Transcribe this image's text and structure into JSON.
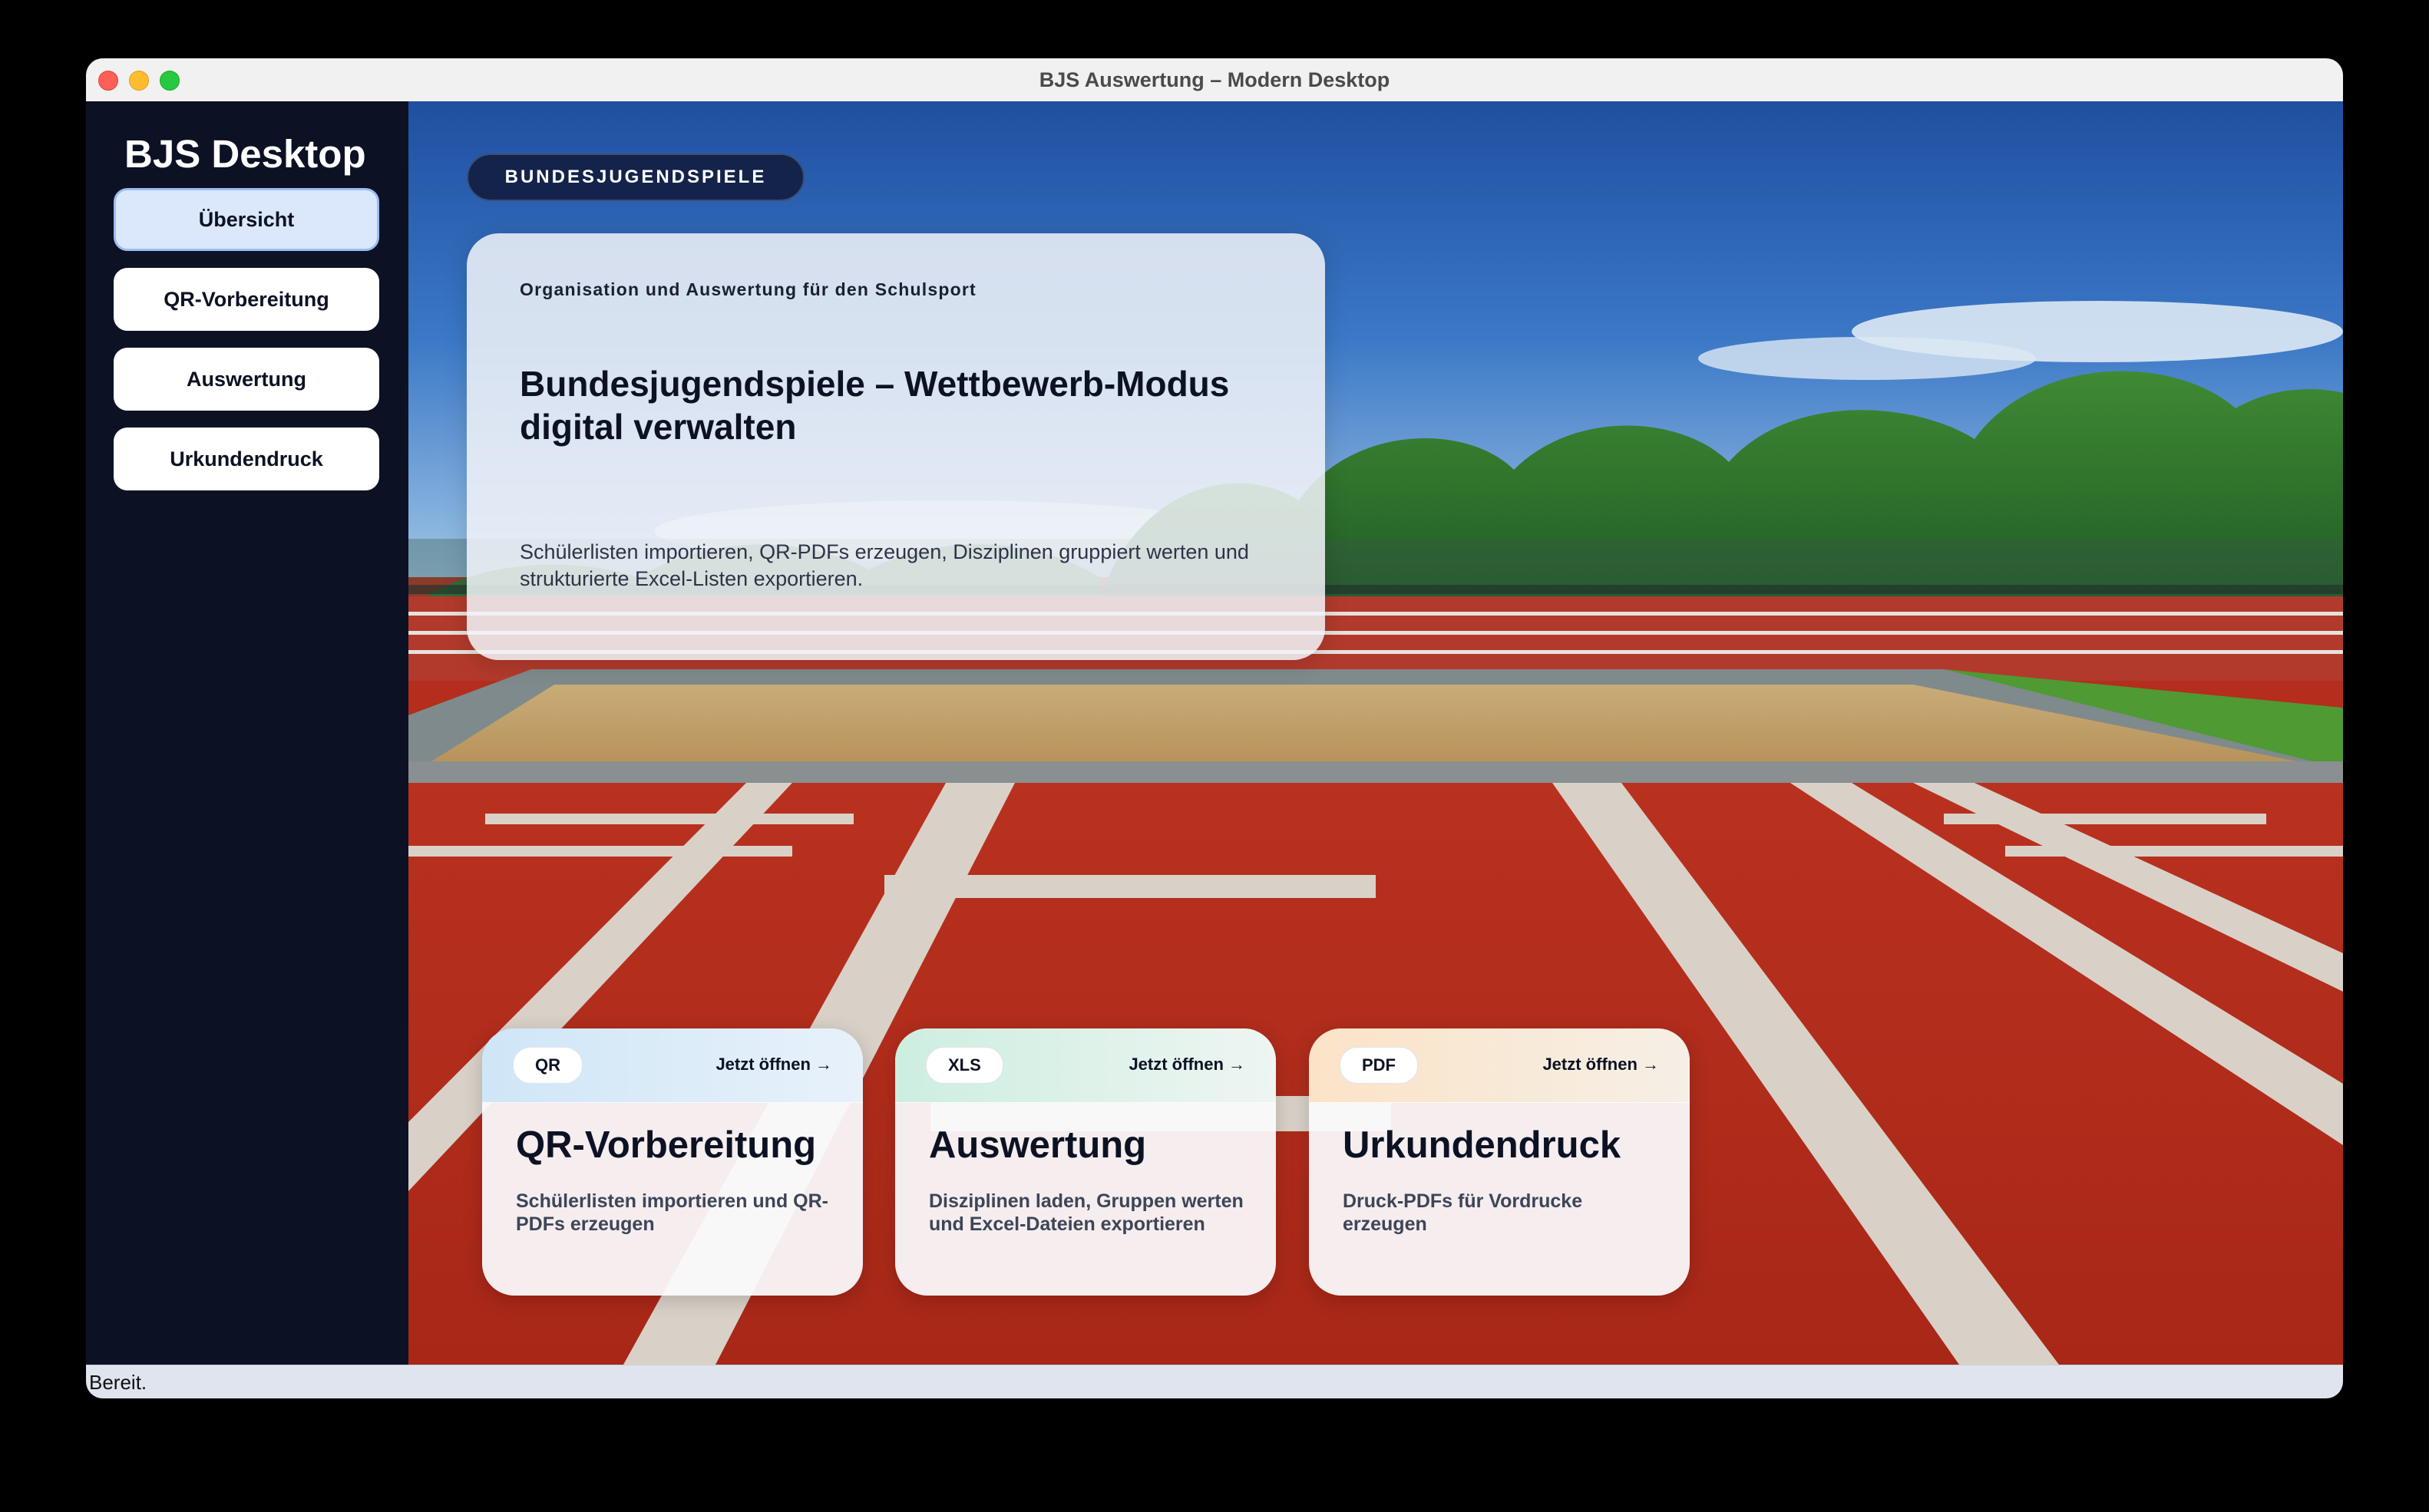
{
  "window": {
    "title": "BJS Auswertung – Modern Desktop"
  },
  "sidebar": {
    "brand": "BJS Desktop",
    "items": [
      {
        "label": "Übersicht",
        "active": true
      },
      {
        "label": "QR-Vorbereitung",
        "active": false
      },
      {
        "label": "Auswertung",
        "active": false
      },
      {
        "label": "Urkundendruck",
        "active": false
      }
    ]
  },
  "hero": {
    "eyebrow": "BUNDESJUGENDSPIELE",
    "kicker": "Organisation und Auswertung für den Schulsport",
    "title": "Bundesjugendspiele – Wettbewerb-Modus digital verwalten",
    "subtitle": "Schülerlisten importieren, QR-PDFs erzeugen, Disziplinen gruppiert werten und strukturierte Excel-Listen exportieren."
  },
  "cards": [
    {
      "tag": "QR",
      "open": "Jetzt öffnen →",
      "title": "QR-Vorbereitung",
      "description": "Schülerlisten importieren und QR-PDFs erzeugen"
    },
    {
      "tag": "XLS",
      "open": "Jetzt öffnen →",
      "title": "Auswertung",
      "description": "Disziplinen laden, Gruppen werten und Excel-Dateien exportieren"
    },
    {
      "tag": "PDF",
      "open": "Jetzt öffnen →",
      "title": "Urkundendruck",
      "description": "Druck-PDFs für Vordrucke erzeugen"
    }
  ],
  "status": {
    "text": "Bereit."
  },
  "colors": {
    "sidebar_bg": "#0c1224",
    "active_nav_bg": "#dbe8fc",
    "track_red": "#b52d1c",
    "sky_blue": "#2a5fb0"
  }
}
